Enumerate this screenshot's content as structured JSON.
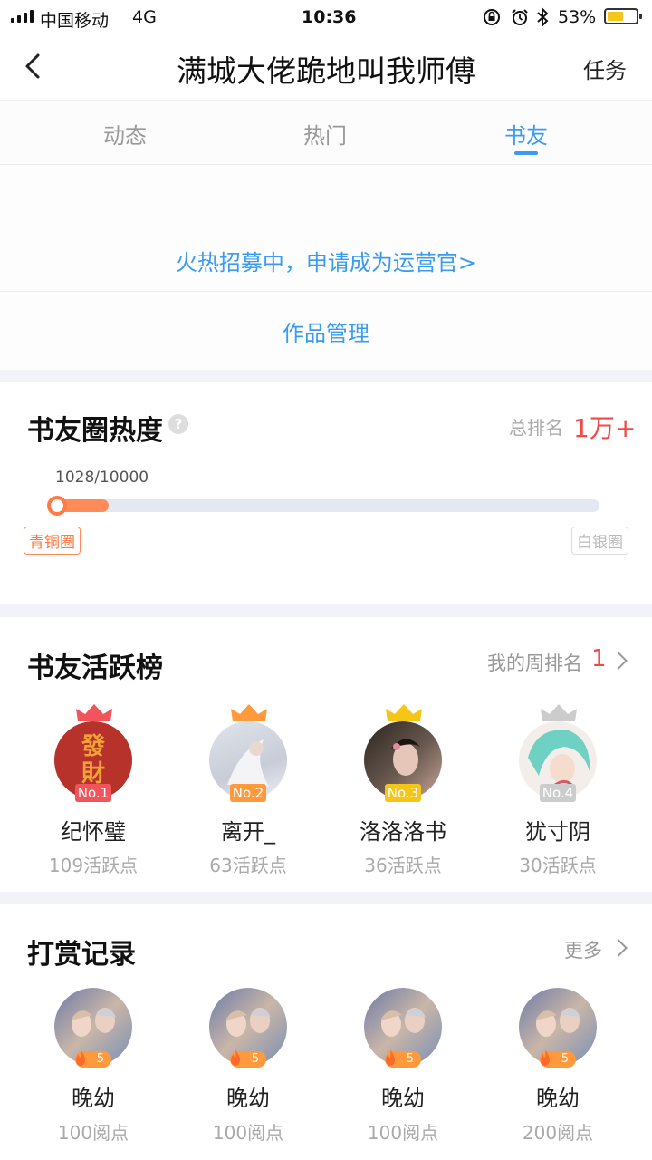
{
  "status_bar": {
    "carrier": "中国移动",
    "network": "4G",
    "time": "10:36",
    "battery": "53%"
  },
  "nav": {
    "title": "满城大佬跪地叫我师傅",
    "right_action": "任务"
  },
  "tabs": [
    {
      "label": "动态"
    },
    {
      "label": "热门"
    },
    {
      "label": "书友",
      "active": true
    }
  ],
  "recruit_link": "火热招募中，申请成为运营官>",
  "manage_link": "作品管理",
  "heat": {
    "title": "书友圈热度",
    "rank_label": "总排名",
    "rank_value": "1万+",
    "progress_text": "1028/10000",
    "progress_fraction": 0.1028,
    "tier_current": "青铜圈",
    "tier_next": "白银圈"
  },
  "activity": {
    "title": "书友活跃榜",
    "my_rank_label": "我的周排名",
    "my_rank_value": "1",
    "members": [
      {
        "rank": "No.1",
        "name": "纪怀璧",
        "points": "109活跃点",
        "rank_color": "#f2545b"
      },
      {
        "rank": "No.2",
        "name": "离开_",
        "points": "63活跃点",
        "rank_color": "#ff9a3c"
      },
      {
        "rank": "No.3",
        "name": "洛洛洛书",
        "points": "36活跃点",
        "rank_color": "#f5c518"
      },
      {
        "rank": "No.4",
        "name": "犹寸阴",
        "points": "30活跃点",
        "rank_color": "#cccccc"
      }
    ]
  },
  "rewards": {
    "title": "打赏记录",
    "more_label": "更多",
    "items": [
      {
        "name": "晚幼",
        "points": "100阅点",
        "level": "5"
      },
      {
        "name": "晚幼",
        "points": "100阅点",
        "level": "5"
      },
      {
        "name": "晚幼",
        "points": "100阅点",
        "level": "5"
      },
      {
        "name": "晚幼",
        "points": "200阅点",
        "level": "5"
      }
    ]
  },
  "colors": {
    "accent": "#3a9bf0",
    "rank_red": "#f04848",
    "progress": "#ff7a45"
  }
}
